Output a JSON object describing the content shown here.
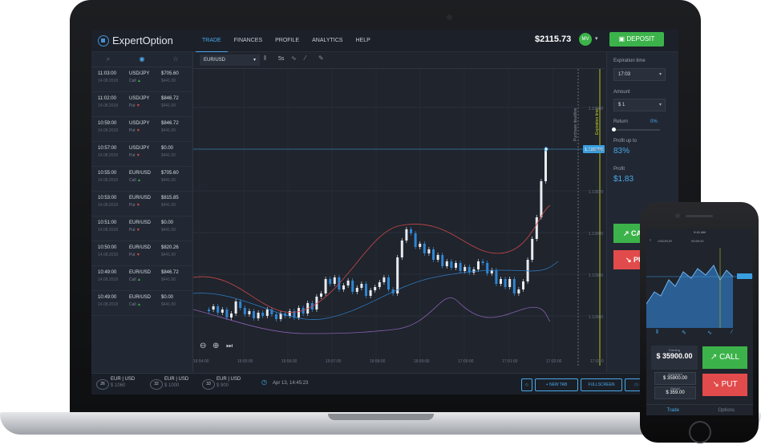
{
  "topbar": {
    "logo": "ExpertOption",
    "nav": [
      "TRADE",
      "FINANCES",
      "PROFILE",
      "ANALYTICS",
      "HELP"
    ],
    "balance": "$2115.73",
    "avatar": "MV",
    "deposit_label": "DEPOSIT"
  },
  "left_tabs": [
    "search-icon",
    "chart-icon",
    "star-icon"
  ],
  "trades": [
    {
      "time": "11:03:00",
      "date": "14.08.2018",
      "pair": "USD/JPY",
      "dir": "Call",
      "amount": "$705.60",
      "sub": "$441.00"
    },
    {
      "time": "11:02:00",
      "date": "14.08.2018",
      "pair": "USD/JPY",
      "dir": "Put",
      "amount": "$846.72",
      "sub": "$441.00"
    },
    {
      "time": "10:59:00",
      "date": "14.08.2018",
      "pair": "USD/JPY",
      "dir": "Put",
      "amount": "$846.72",
      "sub": "$441.00"
    },
    {
      "time": "10:57:00",
      "date": "14.08.2018",
      "pair": "USD/JPY",
      "dir": "Put",
      "amount": "$0.00",
      "sub": "$441.00"
    },
    {
      "time": "10:55:00",
      "date": "14.08.2018",
      "pair": "EUR/USD",
      "dir": "Call",
      "amount": "$705.60",
      "sub": "$441.00"
    },
    {
      "time": "10:53:00",
      "date": "14.08.2018",
      "pair": "EUR/USD",
      "dir": "Put",
      "amount": "$815.85",
      "sub": "$441.00"
    },
    {
      "time": "10:51:00",
      "date": "14.08.2018",
      "pair": "EUR/USD",
      "dir": "Put",
      "amount": "$0.00",
      "sub": "$441.00"
    },
    {
      "time": "10:50:00",
      "date": "14.08.2018",
      "pair": "EUR/USD",
      "dir": "Put",
      "amount": "$820.26",
      "sub": "$441.00"
    },
    {
      "time": "10:49:00",
      "date": "14.08.2018",
      "pair": "EUR/USD",
      "dir": "Call",
      "amount": "$846.72",
      "sub": "$441.00"
    },
    {
      "time": "10:49:00",
      "date": "14.08.2018",
      "pair": "EUR/USD",
      "dir": "Call",
      "amount": "$0.00",
      "sub": "$441.00"
    }
  ],
  "toolbar": {
    "asset": "EUR/USD",
    "timeframe": "5s"
  },
  "chart": {
    "price_marker": "1.130790",
    "y_ticks": [
      "1.13060",
      "1.13040",
      "1.13020",
      "1.13000",
      "1.12980",
      "1.12960"
    ],
    "x_ticks": [
      "16:54:00",
      "16:55:00",
      "16:56:00",
      "16:57:00",
      "16:58:00",
      "16:59:00",
      "17:00:00",
      "17:01:00",
      "17:02:00",
      "17:03:0"
    ],
    "purchase_label": "Purchase deadline",
    "expiration_label": "Expiration time"
  },
  "right_panel": {
    "exp_label": "Expiration time",
    "exp_value": "17:03",
    "amount_label": "Amount",
    "amount_value": "$ 1",
    "return_label": "Return",
    "return_value": "0%",
    "profit_up_label": "Profit up to",
    "profit_up_value": "83%",
    "profit_label": "Profit",
    "profit_value": "$1.83",
    "call": "CALL",
    "put": "PUT"
  },
  "statusbar": {
    "tabs": [
      {
        "num": "26",
        "pair": "EUR | USD",
        "amount": "$ 1060"
      },
      {
        "num": "32",
        "pair": "EUR | USD",
        "amount": "$ 1000"
      },
      {
        "num": "33",
        "pair": "EUR | USD",
        "amount": "$ 900"
      }
    ],
    "datetime": "Apr 13, 14:45:23",
    "new_tab": "+ NEW TAB",
    "fullscreen": "FULLSCREEN"
  },
  "phone": {
    "status": "9:41 AM",
    "asset": "USD/EUR",
    "time": "09:56:00",
    "earning_label": "Earning",
    "earning_value": "$ 35900.00",
    "investment_label": "Investment",
    "investment_value": "$ 35900.00",
    "refund_label": "Refund",
    "refund_value": "$ 359.00",
    "call": "CALL",
    "put": "PUT",
    "tabs": [
      "Trade",
      "Options"
    ]
  }
}
